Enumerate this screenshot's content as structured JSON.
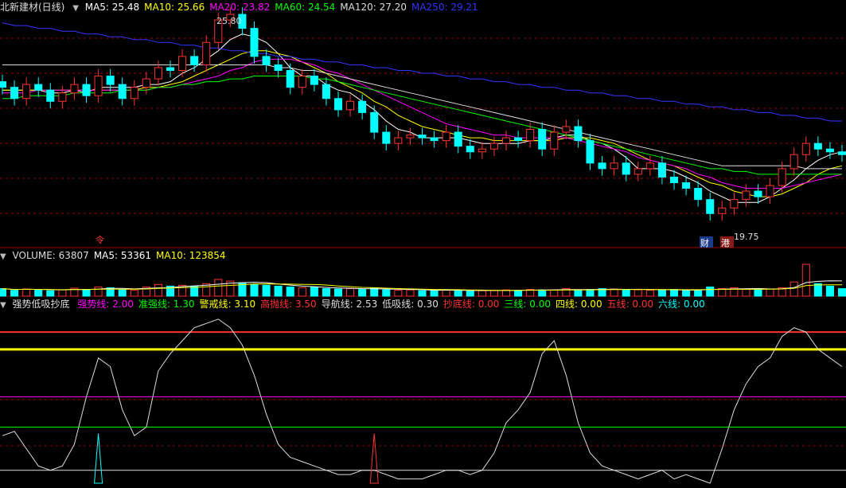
{
  "main": {
    "title": "北新建材(日线)",
    "ma": [
      {
        "label": "MA5: 25.48",
        "color": "#ffffff"
      },
      {
        "label": "MA10: 25.66",
        "color": "#ffff00"
      },
      {
        "label": "MA20: 23.82",
        "color": "#ff00ff"
      },
      {
        "label": "MA60: 24.54",
        "color": "#00ff00"
      },
      {
        "label": "MA120: 27.20",
        "color": "#dddddd"
      },
      {
        "label": "MA250: 29.21",
        "color": "#3333ff"
      }
    ],
    "high_label": "25.80",
    "low_label": "19.75",
    "badges": [
      "财",
      "港"
    ],
    "event_marker": "令"
  },
  "volume": {
    "labels": [
      {
        "label": "VOLUME: 63807",
        "color": "#dddddd"
      },
      {
        "label": "MA5: 53361",
        "color": "#ffffff"
      },
      {
        "label": "MA10: 123854",
        "color": "#ffff00"
      }
    ]
  },
  "indicator": {
    "title": "强势低吸抄底",
    "labels": [
      {
        "label": "强势线: 2.00",
        "color": "#ff00ff"
      },
      {
        "label": "准强线: 1.30",
        "color": "#00ff00"
      },
      {
        "label": "警戒线: 3.10",
        "color": "#ffff00"
      },
      {
        "label": "高抛线: 3.50",
        "color": "#ff3333"
      },
      {
        "label": "导航线: 2.53",
        "color": "#dddddd"
      },
      {
        "label": "低吸线: 0.30",
        "color": "#dddddd"
      },
      {
        "label": "抄底线: 0.00",
        "color": "#ff3333"
      },
      {
        "label": "三线: 0.00",
        "color": "#00ff00"
      },
      {
        "label": "四线: 0.00",
        "color": "#ffff00"
      },
      {
        "label": "五线: 0.00",
        "color": "#ff3333"
      },
      {
        "label": "六线: 0.00",
        "color": "#00ffff"
      }
    ]
  },
  "colors": {
    "up": "#ff3333",
    "down": "#00ffff",
    "ma5": "#ffffff",
    "ma10": "#ffff00",
    "ma20": "#ff00ff",
    "ma60": "#00ff00",
    "ma120": "#dddddd",
    "ma250": "#3333ff",
    "divider": "#a00000"
  },
  "chart_data": {
    "type": "candlestick",
    "price_range": [
      19.0,
      27.0
    ],
    "prices": [
      24.4,
      24.0,
      24.5,
      24.3,
      23.9,
      24.2,
      24.5,
      24.1,
      24.8,
      24.5,
      24.0,
      24.4,
      24.7,
      25.1,
      25.0,
      25.5,
      25.2,
      26.0,
      26.8,
      27.0,
      26.5,
      25.5,
      25.2,
      25.0,
      24.4,
      24.8,
      24.5,
      24.0,
      23.6,
      23.9,
      23.5,
      22.8,
      22.4,
      22.6,
      22.7,
      22.6,
      22.5,
      22.8,
      22.3,
      22.1,
      22.2,
      22.4,
      22.6,
      22.5,
      22.9,
      22.2,
      22.8,
      23.0,
      22.5,
      21.7,
      21.5,
      21.7,
      21.3,
      21.5,
      21.7,
      21.2,
      21.0,
      20.8,
      20.4,
      19.9,
      20.1,
      20.4,
      20.7,
      20.5,
      20.9,
      21.5,
      22.0,
      22.4,
      22.2,
      22.1,
      22.0
    ],
    "ma_series": [
      {
        "name": "MA5",
        "values": [
          24.3,
          24.3,
          24.3,
          24.3,
          24.2,
          24.2,
          24.3,
          24.2,
          24.4,
          24.4,
          24.4,
          24.4,
          24.5,
          24.5,
          24.6,
          24.9,
          25.1,
          25.4,
          25.7,
          26.1,
          26.3,
          26.2,
          26.0,
          25.6,
          25.1,
          24.8,
          24.8,
          24.5,
          24.3,
          24.2,
          23.9,
          23.6,
          23.2,
          22.9,
          22.8,
          22.6,
          22.6,
          22.6,
          22.6,
          22.5,
          22.4,
          22.4,
          22.4,
          22.4,
          22.5,
          22.5,
          22.6,
          22.7,
          22.7,
          22.5,
          22.4,
          22.2,
          21.9,
          21.5,
          21.5,
          21.5,
          21.4,
          21.2,
          21.0,
          20.7,
          20.5,
          20.3,
          20.3,
          20.3,
          20.5,
          20.8,
          21.1,
          21.5,
          21.8,
          22.0,
          22.1
        ]
      },
      {
        "name": "MA10",
        "values": [
          24.3,
          24.3,
          24.3,
          24.3,
          24.3,
          24.3,
          24.3,
          24.3,
          24.3,
          24.3,
          24.3,
          24.3,
          24.4,
          24.4,
          24.5,
          24.6,
          24.8,
          25.0,
          25.2,
          25.4,
          25.6,
          25.7,
          25.7,
          25.6,
          25.5,
          25.3,
          25.1,
          24.9,
          24.6,
          24.4,
          24.2,
          23.9,
          23.7,
          23.4,
          23.2,
          23.0,
          22.9,
          22.8,
          22.7,
          22.6,
          22.6,
          22.5,
          22.5,
          22.5,
          22.5,
          22.5,
          22.5,
          22.6,
          22.6,
          22.6,
          22.5,
          22.4,
          22.2,
          22.0,
          21.8,
          21.7,
          21.6,
          21.4,
          21.2,
          21.0,
          20.9,
          20.7,
          20.6,
          20.5,
          20.5,
          20.6,
          20.8,
          21.0,
          21.3,
          21.5,
          21.6
        ]
      },
      {
        "name": "MA20",
        "values": [
          24.2,
          24.2,
          24.2,
          24.3,
          24.3,
          24.3,
          24.3,
          24.3,
          24.3,
          24.3,
          24.3,
          24.3,
          24.3,
          24.4,
          24.4,
          24.5,
          24.6,
          24.7,
          24.8,
          25.0,
          25.1,
          25.3,
          25.4,
          25.4,
          25.4,
          25.3,
          25.2,
          25.0,
          24.9,
          24.7,
          24.5,
          24.3,
          24.1,
          23.9,
          23.7,
          23.5,
          23.3,
          23.1,
          23.0,
          22.9,
          22.8,
          22.7,
          22.7,
          22.6,
          22.6,
          22.6,
          22.6,
          22.6,
          22.5,
          22.4,
          22.3,
          22.2,
          22.1,
          21.9,
          21.8,
          21.7,
          21.6,
          21.5,
          21.3,
          21.2,
          21.0,
          20.9,
          20.8,
          20.8,
          20.8,
          20.8,
          20.9,
          21.0,
          21.1,
          21.2,
          21.3
        ]
      },
      {
        "name": "MA60",
        "values": [
          24.0,
          24.0,
          24.1,
          24.1,
          24.1,
          24.1,
          24.2,
          24.2,
          24.2,
          24.2,
          24.3,
          24.3,
          24.3,
          24.4,
          24.4,
          24.5,
          24.5,
          24.6,
          24.6,
          24.7,
          24.7,
          24.8,
          24.8,
          24.8,
          24.8,
          24.8,
          24.7,
          24.7,
          24.6,
          24.5,
          24.4,
          24.3,
          24.2,
          24.1,
          24.0,
          23.9,
          23.8,
          23.7,
          23.6,
          23.5,
          23.4,
          23.3,
          23.2,
          23.1,
          23.0,
          22.9,
          22.8,
          22.7,
          22.6,
          22.5,
          22.4,
          22.3,
          22.2,
          22.1,
          22.0,
          21.9,
          21.8,
          21.7,
          21.6,
          21.5,
          21.5,
          21.4,
          21.4,
          21.3,
          21.3,
          21.3,
          21.3,
          21.3,
          21.3,
          21.3,
          21.3
        ]
      },
      {
        "name": "MA120",
        "values": [
          25.2,
          25.2,
          25.2,
          25.2,
          25.2,
          25.2,
          25.2,
          25.2,
          25.2,
          25.2,
          25.2,
          25.2,
          25.2,
          25.2,
          25.2,
          25.2,
          25.2,
          25.2,
          25.2,
          25.2,
          25.2,
          25.2,
          25.2,
          25.1,
          25.1,
          25.0,
          25.0,
          24.9,
          24.8,
          24.7,
          24.6,
          24.5,
          24.4,
          24.3,
          24.2,
          24.1,
          24.0,
          23.9,
          23.8,
          23.7,
          23.6,
          23.5,
          23.4,
          23.3,
          23.2,
          23.1,
          23.0,
          22.9,
          22.8,
          22.7,
          22.6,
          22.5,
          22.4,
          22.3,
          22.2,
          22.1,
          22.0,
          21.9,
          21.8,
          21.7,
          21.6,
          21.6,
          21.6,
          21.6,
          21.6,
          21.6,
          21.6,
          21.5,
          21.5,
          21.5,
          21.5
        ]
      },
      {
        "name": "MA250",
        "values": [
          26.7,
          26.6,
          26.6,
          26.5,
          26.5,
          26.4,
          26.4,
          26.3,
          26.3,
          26.2,
          26.2,
          26.1,
          26.1,
          26.0,
          26.0,
          25.9,
          25.9,
          25.8,
          25.8,
          25.7,
          25.7,
          25.6,
          25.6,
          25.5,
          25.5,
          25.4,
          25.4,
          25.3,
          25.3,
          25.2,
          25.2,
          25.1,
          25.1,
          25.0,
          25.0,
          24.9,
          24.9,
          24.8,
          24.8,
          24.7,
          24.7,
          24.6,
          24.6,
          24.5,
          24.5,
          24.4,
          24.4,
          24.3,
          24.3,
          24.2,
          24.2,
          24.1,
          24.1,
          24.0,
          24.0,
          23.9,
          23.9,
          23.8,
          23.8,
          23.7,
          23.7,
          23.6,
          23.6,
          23.5,
          23.5,
          23.4,
          23.4,
          23.3,
          23.3,
          23.2,
          23.2
        ]
      }
    ],
    "volume_range": [
      0,
      80000
    ],
    "volume": [
      18000,
      14000,
      17000,
      16000,
      13000,
      15000,
      19000,
      16000,
      22000,
      20000,
      15000,
      14000,
      22000,
      28000,
      24000,
      26000,
      23000,
      30000,
      40000,
      36000,
      32000,
      28000,
      26000,
      24000,
      22000,
      20000,
      21000,
      18000,
      17000,
      18000,
      16000,
      20000,
      15000,
      14000,
      15000,
      13000,
      14000,
      15000,
      14000,
      12000,
      13000,
      14000,
      15000,
      14000,
      16000,
      15000,
      15000,
      18000,
      14000,
      16000,
      18000,
      17000,
      16000,
      15000,
      14000,
      15000,
      16000,
      14000,
      13000,
      22000,
      18000,
      20000,
      16000,
      15000,
      17000,
      20000,
      34000,
      76000,
      30000,
      24000,
      18000
    ],
    "indicator_range": [
      0,
      4.0
    ],
    "indicator_levels": [
      {
        "name": "高抛线",
        "value": 3.5,
        "color": "#ff3333"
      },
      {
        "name": "警戒线",
        "value": 3.1,
        "color": "#ffff00"
      },
      {
        "name": "强势线",
        "value": 2.0,
        "color": "#ff00ff"
      },
      {
        "name": "准强线",
        "value": 1.3,
        "color": "#00ff00"
      },
      {
        "name": "低吸线",
        "value": 0.3,
        "color": "#dddddd"
      }
    ],
    "indicator_line": [
      1.1,
      1.2,
      0.8,
      0.4,
      0.3,
      0.4,
      0.9,
      2.0,
      2.9,
      2.7,
      1.7,
      1.1,
      1.3,
      2.6,
      3.0,
      3.3,
      3.6,
      3.7,
      3.8,
      3.6,
      3.2,
      2.5,
      1.6,
      0.9,
      0.6,
      0.5,
      0.4,
      0.3,
      0.2,
      0.2,
      0.3,
      0.3,
      0.2,
      0.1,
      0.1,
      0.1,
      0.2,
      0.3,
      0.3,
      0.2,
      0.3,
      0.7,
      1.4,
      1.7,
      2.1,
      3.0,
      3.3,
      2.5,
      1.4,
      0.7,
      0.4,
      0.3,
      0.2,
      0.1,
      0.2,
      0.3,
      0.1,
      0.2,
      0.1,
      0.0,
      0.8,
      1.7,
      2.3,
      2.7,
      2.9,
      3.4,
      3.6,
      3.5,
      3.1,
      2.9,
      2.7
    ],
    "spikes": [
      {
        "index": 8,
        "value": 1.15,
        "color": "#00ffff"
      },
      {
        "index": 31,
        "value": 1.15,
        "color": "#ff3333"
      }
    ]
  }
}
